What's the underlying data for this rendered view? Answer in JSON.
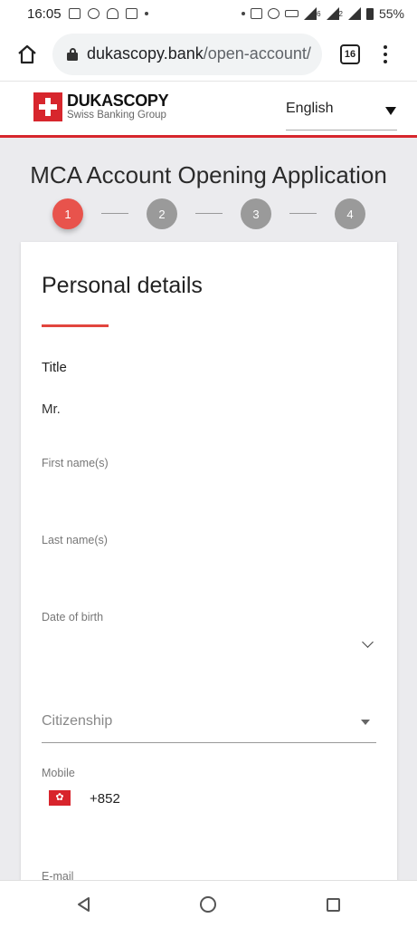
{
  "status_bar": {
    "time": "16:05",
    "battery": "55%",
    "network_labels": [
      "6",
      "2"
    ]
  },
  "browser": {
    "url_host": "dukascopy.bank",
    "url_path": "/open-account/",
    "tab_count": "16"
  },
  "site": {
    "brand": "DUKASCOPY",
    "tagline": "Swiss Banking Group",
    "language": "English"
  },
  "page": {
    "title": "MCA Account Opening Application",
    "steps": [
      "1",
      "2",
      "3",
      "4"
    ],
    "active_step": 1
  },
  "form": {
    "section_title": "Personal details",
    "title_label": "Title",
    "title_value": "Mr.",
    "first_name_label": "First name(s)",
    "last_name_label": "Last name(s)",
    "dob_label": "Date of birth",
    "citizenship_placeholder": "Citizenship",
    "mobile_label": "Mobile",
    "dial_code": "+852",
    "email_label": "E-mail"
  },
  "colors": {
    "brand_red": "#d7262d",
    "active_step": "#e8534c",
    "inactive_step": "#9a9a9a"
  },
  "icons": [
    "home-icon",
    "lock-icon",
    "tabs-icon",
    "more-vert-icon",
    "caret-down-icon",
    "chevron-down-icon",
    "hk-flag-icon",
    "nav-back-icon",
    "nav-home-icon",
    "nav-recents-icon"
  ]
}
